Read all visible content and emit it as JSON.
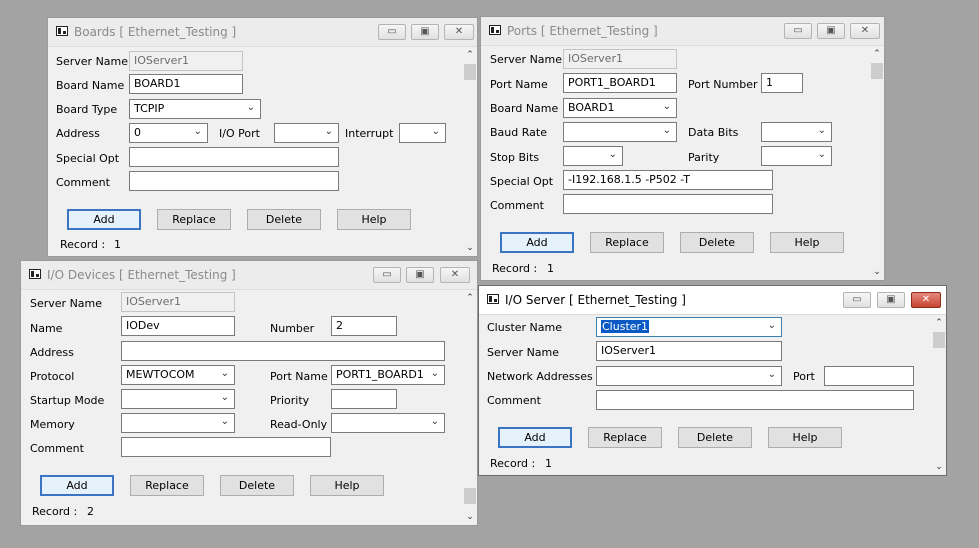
{
  "common": {
    "server_name_label": "Server Name",
    "comment_label": "Comment",
    "add": "Add",
    "replace": "Replace",
    "delete": "Delete",
    "help": "Help",
    "record_label": "Record :",
    "minimize": "▭",
    "maximize": "▣",
    "close": "✕"
  },
  "boards": {
    "title": "Boards [ Ethernet_Testing ]",
    "server_name": "IOServer1",
    "board_name_label": "Board Name",
    "board_name": "BOARD1",
    "board_type_label": "Board Type",
    "board_type": "TCPIP",
    "address_label": "Address",
    "address": "0",
    "io_port_label": "I/O Port",
    "io_port": "",
    "interrupt_label": "Interrupt",
    "interrupt": "",
    "special_opt_label": "Special Opt",
    "special_opt": "",
    "comment": "",
    "record": "1"
  },
  "ports": {
    "title": "Ports [ Ethernet_Testing ]",
    "server_name": "IOServer1",
    "port_name_label": "Port Name",
    "port_name": "PORT1_BOARD1",
    "port_number_label": "Port Number",
    "port_number": "1",
    "board_name_label": "Board Name",
    "board_name": "BOARD1",
    "baud_rate_label": "Baud Rate",
    "baud_rate": "",
    "data_bits_label": "Data Bits",
    "data_bits": "",
    "stop_bits_label": "Stop Bits",
    "stop_bits": "",
    "parity_label": "Parity",
    "parity": "",
    "special_opt_label": "Special Opt",
    "special_opt": "-I192.168.1.5 -P502 -T",
    "comment": "",
    "record": "1"
  },
  "io_devices": {
    "title": "I/O Devices [ Ethernet_Testing ]",
    "server_name": "IOServer1",
    "name_label": "Name",
    "name": "IODev",
    "number_label": "Number",
    "number": "2",
    "address_label": "Address",
    "address": "",
    "protocol_label": "Protocol",
    "protocol": "MEWTOCOM",
    "port_name_label": "Port Name",
    "port_name": "PORT1_BOARD1",
    "startup_mode_label": "Startup Mode",
    "startup_mode": "",
    "priority_label": "Priority",
    "priority": "",
    "memory_label": "Memory",
    "memory": "",
    "read_only_label": "Read-Only",
    "read_only": "",
    "comment": "",
    "record": "2"
  },
  "io_server": {
    "title": "I/O Server [ Ethernet_Testing ]",
    "cluster_name_label": "Cluster Name",
    "cluster_name": "Cluster1",
    "server_name": "IOServer1",
    "network_addresses_label": "Network Addresses",
    "network_addresses": "",
    "port_label": "Port",
    "port": "",
    "comment": "",
    "record": "1"
  }
}
